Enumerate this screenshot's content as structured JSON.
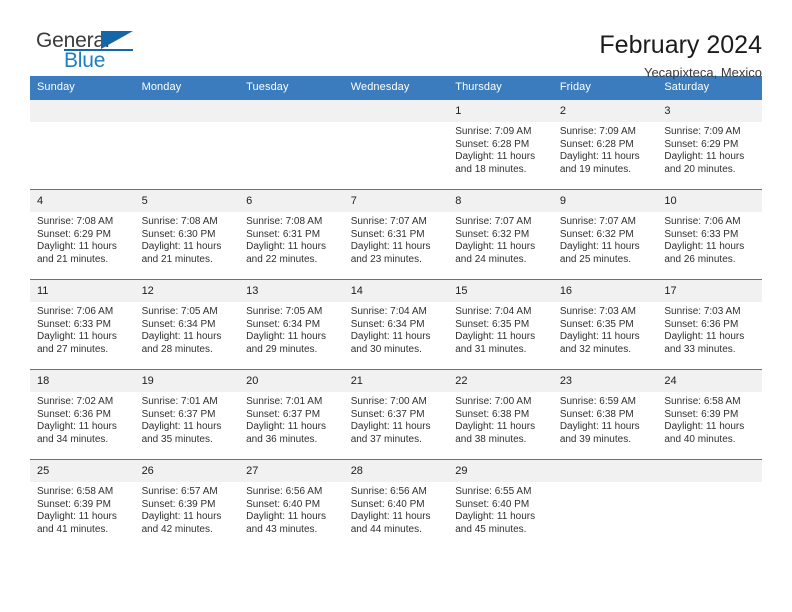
{
  "brand": {
    "name_top": "General",
    "name_bottom": "Blue",
    "colors": {
      "dark": "#3b3b3b",
      "blue": "#1f7fc4",
      "triangle": "#1667a8"
    }
  },
  "header": {
    "title": "February 2024",
    "subtitle": "Yecapixteca, Mexico"
  },
  "theme": {
    "header_blue": "#3a7cbe",
    "daynum_band": "#f1f1f1",
    "text": "#303030"
  },
  "weekdays": [
    "Sunday",
    "Monday",
    "Tuesday",
    "Wednesday",
    "Thursday",
    "Friday",
    "Saturday"
  ],
  "weeks": [
    [
      {
        "day": "",
        "sunrise": "",
        "sunset": "",
        "daylight1": "",
        "daylight2": ""
      },
      {
        "day": "",
        "sunrise": "",
        "sunset": "",
        "daylight1": "",
        "daylight2": ""
      },
      {
        "day": "",
        "sunrise": "",
        "sunset": "",
        "daylight1": "",
        "daylight2": ""
      },
      {
        "day": "",
        "sunrise": "",
        "sunset": "",
        "daylight1": "",
        "daylight2": ""
      },
      {
        "day": "1",
        "sunrise": "Sunrise: 7:09 AM",
        "sunset": "Sunset: 6:28 PM",
        "daylight1": "Daylight: 11 hours",
        "daylight2": "and 18 minutes."
      },
      {
        "day": "2",
        "sunrise": "Sunrise: 7:09 AM",
        "sunset": "Sunset: 6:28 PM",
        "daylight1": "Daylight: 11 hours",
        "daylight2": "and 19 minutes."
      },
      {
        "day": "3",
        "sunrise": "Sunrise: 7:09 AM",
        "sunset": "Sunset: 6:29 PM",
        "daylight1": "Daylight: 11 hours",
        "daylight2": "and 20 minutes."
      }
    ],
    [
      {
        "day": "4",
        "sunrise": "Sunrise: 7:08 AM",
        "sunset": "Sunset: 6:29 PM",
        "daylight1": "Daylight: 11 hours",
        "daylight2": "and 21 minutes."
      },
      {
        "day": "5",
        "sunrise": "Sunrise: 7:08 AM",
        "sunset": "Sunset: 6:30 PM",
        "daylight1": "Daylight: 11 hours",
        "daylight2": "and 21 minutes."
      },
      {
        "day": "6",
        "sunrise": "Sunrise: 7:08 AM",
        "sunset": "Sunset: 6:31 PM",
        "daylight1": "Daylight: 11 hours",
        "daylight2": "and 22 minutes."
      },
      {
        "day": "7",
        "sunrise": "Sunrise: 7:07 AM",
        "sunset": "Sunset: 6:31 PM",
        "daylight1": "Daylight: 11 hours",
        "daylight2": "and 23 minutes."
      },
      {
        "day": "8",
        "sunrise": "Sunrise: 7:07 AM",
        "sunset": "Sunset: 6:32 PM",
        "daylight1": "Daylight: 11 hours",
        "daylight2": "and 24 minutes."
      },
      {
        "day": "9",
        "sunrise": "Sunrise: 7:07 AM",
        "sunset": "Sunset: 6:32 PM",
        "daylight1": "Daylight: 11 hours",
        "daylight2": "and 25 minutes."
      },
      {
        "day": "10",
        "sunrise": "Sunrise: 7:06 AM",
        "sunset": "Sunset: 6:33 PM",
        "daylight1": "Daylight: 11 hours",
        "daylight2": "and 26 minutes."
      }
    ],
    [
      {
        "day": "11",
        "sunrise": "Sunrise: 7:06 AM",
        "sunset": "Sunset: 6:33 PM",
        "daylight1": "Daylight: 11 hours",
        "daylight2": "and 27 minutes."
      },
      {
        "day": "12",
        "sunrise": "Sunrise: 7:05 AM",
        "sunset": "Sunset: 6:34 PM",
        "daylight1": "Daylight: 11 hours",
        "daylight2": "and 28 minutes."
      },
      {
        "day": "13",
        "sunrise": "Sunrise: 7:05 AM",
        "sunset": "Sunset: 6:34 PM",
        "daylight1": "Daylight: 11 hours",
        "daylight2": "and 29 minutes."
      },
      {
        "day": "14",
        "sunrise": "Sunrise: 7:04 AM",
        "sunset": "Sunset: 6:34 PM",
        "daylight1": "Daylight: 11 hours",
        "daylight2": "and 30 minutes."
      },
      {
        "day": "15",
        "sunrise": "Sunrise: 7:04 AM",
        "sunset": "Sunset: 6:35 PM",
        "daylight1": "Daylight: 11 hours",
        "daylight2": "and 31 minutes."
      },
      {
        "day": "16",
        "sunrise": "Sunrise: 7:03 AM",
        "sunset": "Sunset: 6:35 PM",
        "daylight1": "Daylight: 11 hours",
        "daylight2": "and 32 minutes."
      },
      {
        "day": "17",
        "sunrise": "Sunrise: 7:03 AM",
        "sunset": "Sunset: 6:36 PM",
        "daylight1": "Daylight: 11 hours",
        "daylight2": "and 33 minutes."
      }
    ],
    [
      {
        "day": "18",
        "sunrise": "Sunrise: 7:02 AM",
        "sunset": "Sunset: 6:36 PM",
        "daylight1": "Daylight: 11 hours",
        "daylight2": "and 34 minutes."
      },
      {
        "day": "19",
        "sunrise": "Sunrise: 7:01 AM",
        "sunset": "Sunset: 6:37 PM",
        "daylight1": "Daylight: 11 hours",
        "daylight2": "and 35 minutes."
      },
      {
        "day": "20",
        "sunrise": "Sunrise: 7:01 AM",
        "sunset": "Sunset: 6:37 PM",
        "daylight1": "Daylight: 11 hours",
        "daylight2": "and 36 minutes."
      },
      {
        "day": "21",
        "sunrise": "Sunrise: 7:00 AM",
        "sunset": "Sunset: 6:37 PM",
        "daylight1": "Daylight: 11 hours",
        "daylight2": "and 37 minutes."
      },
      {
        "day": "22",
        "sunrise": "Sunrise: 7:00 AM",
        "sunset": "Sunset: 6:38 PM",
        "daylight1": "Daylight: 11 hours",
        "daylight2": "and 38 minutes."
      },
      {
        "day": "23",
        "sunrise": "Sunrise: 6:59 AM",
        "sunset": "Sunset: 6:38 PM",
        "daylight1": "Daylight: 11 hours",
        "daylight2": "and 39 minutes."
      },
      {
        "day": "24",
        "sunrise": "Sunrise: 6:58 AM",
        "sunset": "Sunset: 6:39 PM",
        "daylight1": "Daylight: 11 hours",
        "daylight2": "and 40 minutes."
      }
    ],
    [
      {
        "day": "25",
        "sunrise": "Sunrise: 6:58 AM",
        "sunset": "Sunset: 6:39 PM",
        "daylight1": "Daylight: 11 hours",
        "daylight2": "and 41 minutes."
      },
      {
        "day": "26",
        "sunrise": "Sunrise: 6:57 AM",
        "sunset": "Sunset: 6:39 PM",
        "daylight1": "Daylight: 11 hours",
        "daylight2": "and 42 minutes."
      },
      {
        "day": "27",
        "sunrise": "Sunrise: 6:56 AM",
        "sunset": "Sunset: 6:40 PM",
        "daylight1": "Daylight: 11 hours",
        "daylight2": "and 43 minutes."
      },
      {
        "day": "28",
        "sunrise": "Sunrise: 6:56 AM",
        "sunset": "Sunset: 6:40 PM",
        "daylight1": "Daylight: 11 hours",
        "daylight2": "and 44 minutes."
      },
      {
        "day": "29",
        "sunrise": "Sunrise: 6:55 AM",
        "sunset": "Sunset: 6:40 PM",
        "daylight1": "Daylight: 11 hours",
        "daylight2": "and 45 minutes."
      },
      {
        "day": "",
        "sunrise": "",
        "sunset": "",
        "daylight1": "",
        "daylight2": ""
      },
      {
        "day": "",
        "sunrise": "",
        "sunset": "",
        "daylight1": "",
        "daylight2": ""
      }
    ]
  ]
}
